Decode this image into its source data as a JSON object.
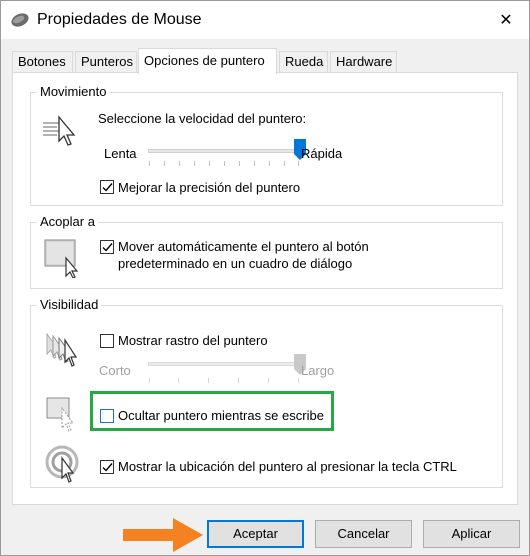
{
  "window": {
    "title": "Propiedades de Mouse",
    "close_glyph": "✕"
  },
  "tabs": [
    {
      "label": "Botones",
      "active": false
    },
    {
      "label": "Punteros",
      "active": false
    },
    {
      "label": "Opciones de puntero",
      "active": true
    },
    {
      "label": "Rueda",
      "active": false
    },
    {
      "label": "Hardware",
      "active": false
    }
  ],
  "movimiento": {
    "title": "Movimiento",
    "speed_prompt": "Seleccione la velocidad del puntero:",
    "slow_label": "Lenta",
    "fast_label": "Rápida",
    "speed_level": 1.0,
    "precision_label": "Mejorar la precisión del puntero",
    "precision_checked": true
  },
  "acoplar": {
    "title": "Acoplar a",
    "snap_label_line1": "Mover automáticamente el puntero al botón",
    "snap_label_line2": "predeterminado en un cuadro de diálogo",
    "snap_checked": true
  },
  "visibilidad": {
    "title": "Visibilidad",
    "trail_label": "Mostrar rastro del puntero",
    "trail_checked": false,
    "short_label": "Corto",
    "long_label": "Largo",
    "trail_level": 1.0,
    "hide_label": "Ocultar puntero mientras se escribe",
    "hide_checked": false,
    "ctrl_label": "Mostrar la ubicación del puntero al presionar la tecla CTRL",
    "ctrl_checked": true
  },
  "buttons": {
    "accept": "Aceptar",
    "cancel": "Cancelar",
    "apply": "Aplicar"
  },
  "colors": {
    "highlight": "#28a745",
    "arrow": "#f58220",
    "accent": "#0078d7"
  }
}
